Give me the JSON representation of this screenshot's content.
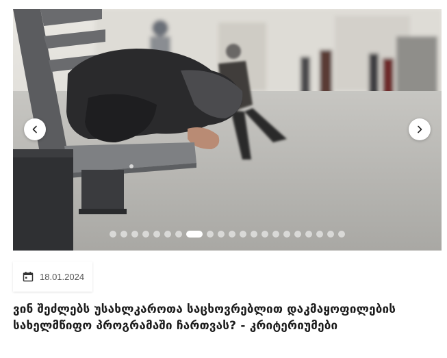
{
  "carousel": {
    "image_alt": "",
    "prev_icon": "chevron-left-icon",
    "next_icon": "chevron-right-icon",
    "slide_count": 21,
    "active_slide": 8
  },
  "article": {
    "date": "18.01.2024",
    "date_icon": "calendar-icon",
    "title": "ვინ შეძლებს უსახლკაროთა საცხოვრებლით დაკმაყოფილების სახელმწიფო პროგრამაში ჩართვას? - კრიტერიუმები"
  },
  "colors": {
    "badge_text": "#555555",
    "title_text": "#1a1a1a",
    "dot_inactive": "rgba(255,255,255,0.55)",
    "dot_active": "#ffffff"
  }
}
